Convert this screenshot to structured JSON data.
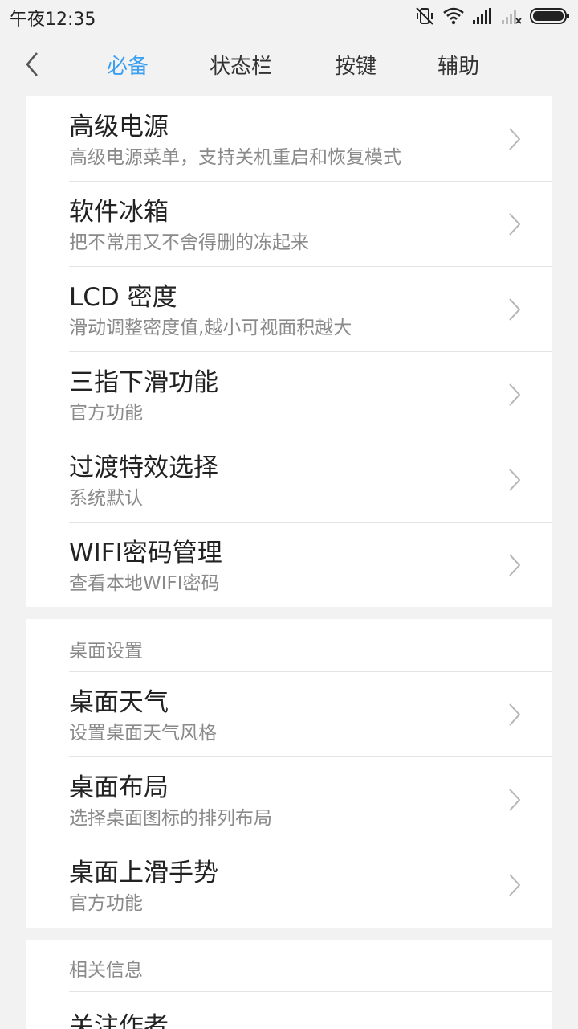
{
  "status_bar": {
    "time": "午夜12:35",
    "icons": [
      "mute-vibrate-icon",
      "wifi-icon",
      "signal-icon",
      "signal-no-service-icon",
      "battery-icon"
    ]
  },
  "nav": {
    "back_icon": "chevron-left-icon",
    "tabs": [
      {
        "label": "必备",
        "active": true
      },
      {
        "label": "状态栏",
        "active": false
      },
      {
        "label": "按键",
        "active": false
      },
      {
        "label": "辅助",
        "active": false
      }
    ],
    "active_color": "#3a9ff0"
  },
  "section1": {
    "items": [
      {
        "title": "高级电源",
        "subtitle": "高级电源菜单，支持关机重启和恢复模式"
      },
      {
        "title": "软件冰箱",
        "subtitle": "把不常用又不舍得删的冻起来"
      },
      {
        "title": "LCD 密度",
        "subtitle": "滑动调整密度值,越小可视面积越大"
      },
      {
        "title": "三指下滑功能",
        "subtitle": "官方功能"
      },
      {
        "title": "过渡特效选择",
        "subtitle": "系统默认"
      },
      {
        "title": "WIFI密码管理",
        "subtitle": "查看本地WIFI密码"
      }
    ]
  },
  "section2": {
    "header": "桌面设置",
    "items": [
      {
        "title": "桌面天气",
        "subtitle": "设置桌面天气风格"
      },
      {
        "title": "桌面布局",
        "subtitle": "选择桌面图标的排列布局"
      },
      {
        "title": "桌面上滑手势",
        "subtitle": "官方功能"
      }
    ]
  },
  "section3": {
    "header": "相关信息",
    "items": [
      {
        "title": "关注作者"
      }
    ]
  }
}
